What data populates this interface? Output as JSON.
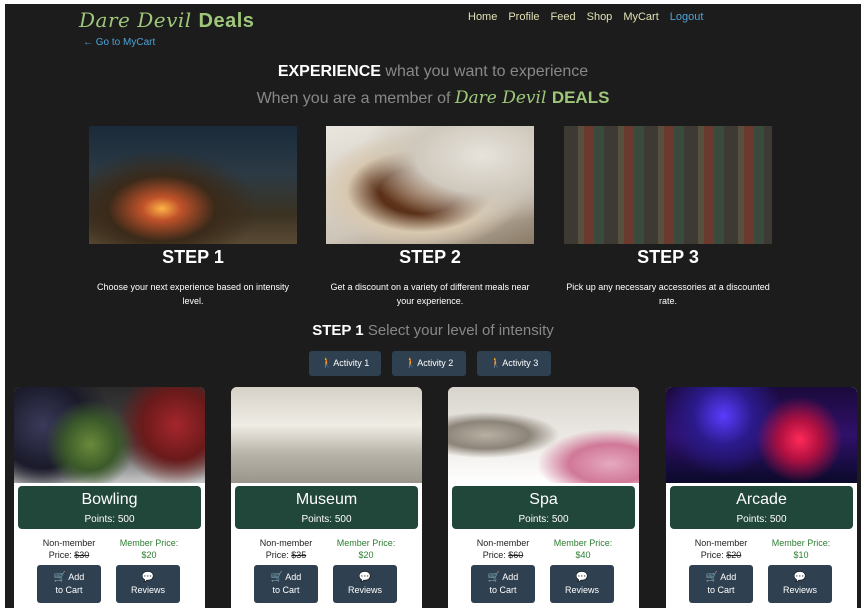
{
  "brand": {
    "name": "Dare Devil",
    "suffix": "Deals"
  },
  "nav": {
    "home": "Home",
    "profile": "Profile",
    "feed": "Feed",
    "shop": "Shop",
    "mycart": "MyCart",
    "logout": "Logout"
  },
  "back_link": "← Go to MyCart",
  "headline": {
    "line1_bold": "EXPERIENCE",
    "line1_rest": " what you want to experience",
    "line2": "When you are a member of ",
    "line2_brand": "Dare Devil",
    "line2_suffix": "DEALS"
  },
  "steps": [
    {
      "title": "STEP 1",
      "desc": "Choose your next experience based on intensity level."
    },
    {
      "title": "STEP 2",
      "desc": "Get a discount on a variety of different meals near your experience."
    },
    {
      "title": "STEP 3",
      "desc": "Pick up any necessary accessories at a discounted rate."
    }
  ],
  "select_heading": {
    "bold": "STEP 1",
    "rest": " Select your level of intensity"
  },
  "activities": [
    "Activity 1",
    "Activity 2",
    "Activity 3"
  ],
  "cards": [
    {
      "name": "Bowling",
      "points": "Points: 500",
      "nonmember_label": "Non-member",
      "nonmember_price_label": "Price: ",
      "nonmember_price": "$30",
      "member_label": "Member Price:",
      "member_price": "$20",
      "add_line1": "Add",
      "add_line2": "to Cart",
      "reviews": "Reviews"
    },
    {
      "name": "Museum",
      "points": "Points: 500",
      "nonmember_label": "Non-member",
      "nonmember_price_label": "Price: ",
      "nonmember_price": "$35",
      "member_label": "Member Price:",
      "member_price": "$20",
      "add_line1": "Add",
      "add_line2": "to Cart",
      "reviews": "Reviews"
    },
    {
      "name": "Spa",
      "points": "Points: 500",
      "nonmember_label": "Non-member",
      "nonmember_price_label": "Price: ",
      "nonmember_price": "$60",
      "member_label": "Member Price:",
      "member_price": "$40",
      "add_line1": "Add",
      "add_line2": "to Cart",
      "reviews": "Reviews"
    },
    {
      "name": "Arcade",
      "points": "Points: 500",
      "nonmember_label": "Non-member",
      "nonmember_price_label": "Price: ",
      "nonmember_price": "$20",
      "member_label": "Member Price:",
      "member_price": "$10",
      "add_line1": "Add",
      "add_line2": "to Cart",
      "reviews": "Reviews"
    }
  ],
  "icons": {
    "activity": "hiking-icon",
    "cart": "cart-icon",
    "reviews": "comments-icon"
  },
  "colors": {
    "background": "#1c1c1c",
    "brand_green": "#9fc77a",
    "card_banner": "#21463a",
    "button": "#2f4050",
    "link_blue": "#4da3d8",
    "member_price_green": "#2e7d32"
  }
}
